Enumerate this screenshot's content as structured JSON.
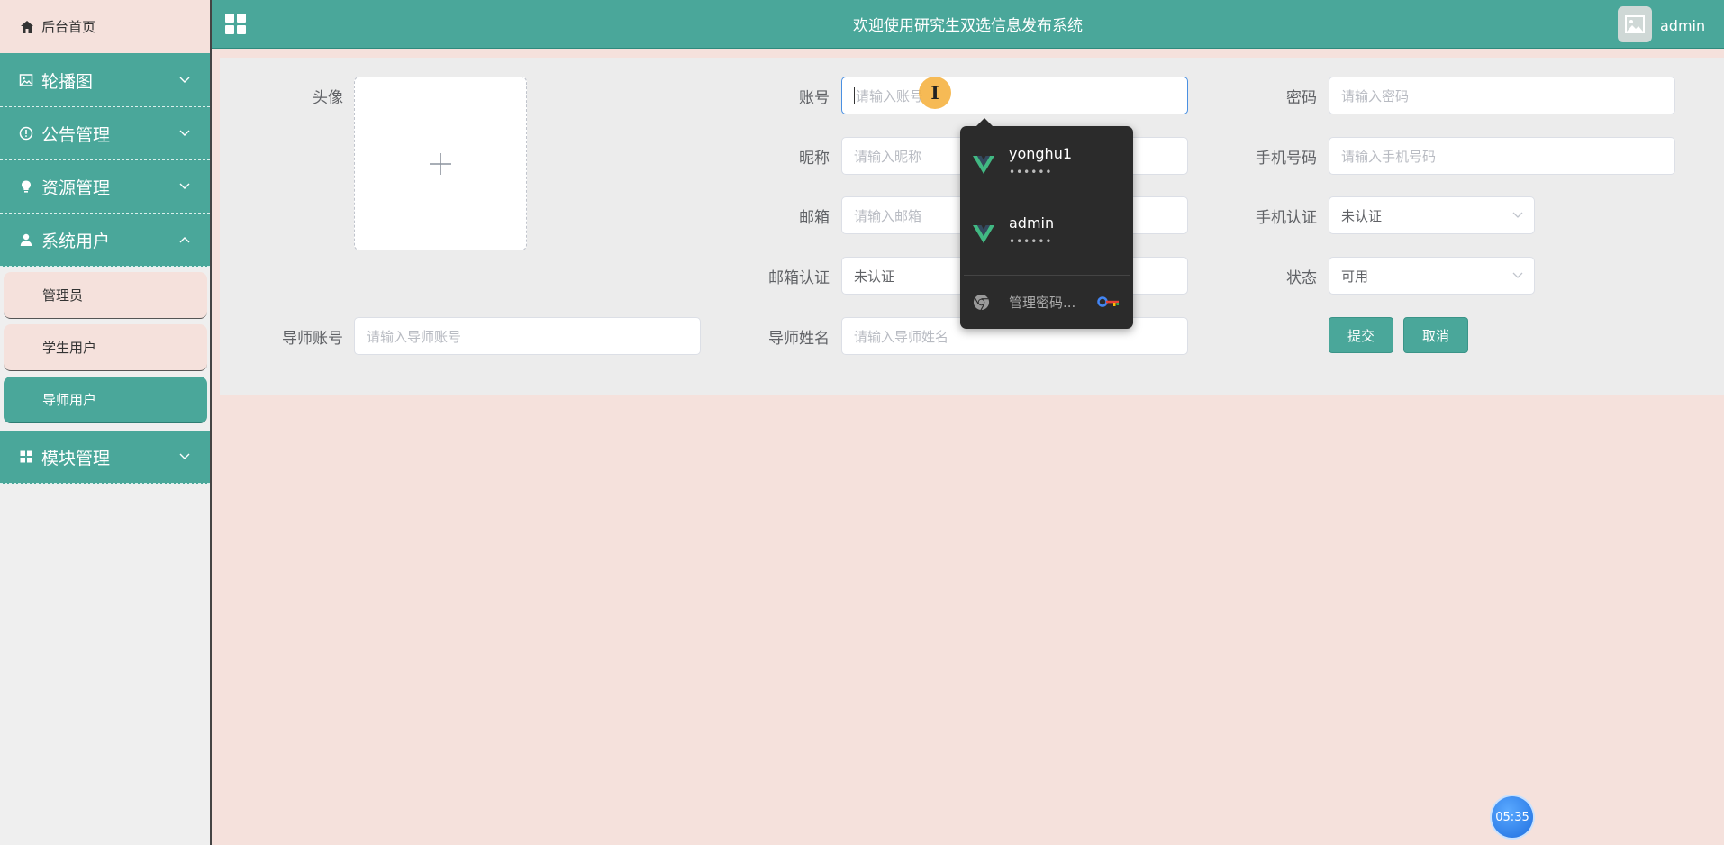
{
  "header": {
    "title": "欢迎使用研究生双选信息发布系统",
    "user_name": "admin"
  },
  "sidebar": {
    "home": "后台首页",
    "menus": [
      {
        "label": "轮播图",
        "icon": "image-icon"
      },
      {
        "label": "公告管理",
        "icon": "info-circle-icon"
      },
      {
        "label": "资源管理",
        "icon": "bulb-icon"
      },
      {
        "label": "系统用户",
        "icon": "user-icon"
      },
      {
        "label": "模块管理",
        "icon": "grid-icon"
      }
    ],
    "sub_items": [
      {
        "label": "管理员"
      },
      {
        "label": "学生用户"
      },
      {
        "label": "导师用户",
        "active": true
      }
    ]
  },
  "form": {
    "avatar_label": "头像",
    "account_label": "账号",
    "account_placeholder": "请输入账号",
    "password_label": "密码",
    "password_placeholder": "请输入密码",
    "nickname_label": "昵称",
    "nickname_placeholder": "请输入昵称",
    "phone_label": "手机号码",
    "phone_placeholder": "请输入手机号码",
    "email_label": "邮箱",
    "email_placeholder": "请输入邮箱",
    "phone_verify_label": "手机认证",
    "phone_verify_value": "未认证",
    "email_verify_label": "邮箱认证",
    "email_verify_value": "未认证",
    "status_label": "状态",
    "status_value": "可用",
    "tutor_account_label": "导师账号",
    "tutor_account_placeholder": "请输入导师账号",
    "tutor_name_label": "导师姓名",
    "tutor_name_placeholder": "请输入导师姓名",
    "submit": "提交",
    "cancel": "取消"
  },
  "password_popup": {
    "entries": [
      {
        "user": "yonghu1",
        "masked": "••••••"
      },
      {
        "user": "admin",
        "masked": "••••••"
      }
    ],
    "manage": "管理密码..."
  },
  "timer": "05:35",
  "colors": {
    "primary": "#4aa79a",
    "background": "#f5e1dc",
    "panel": "#ececec"
  }
}
